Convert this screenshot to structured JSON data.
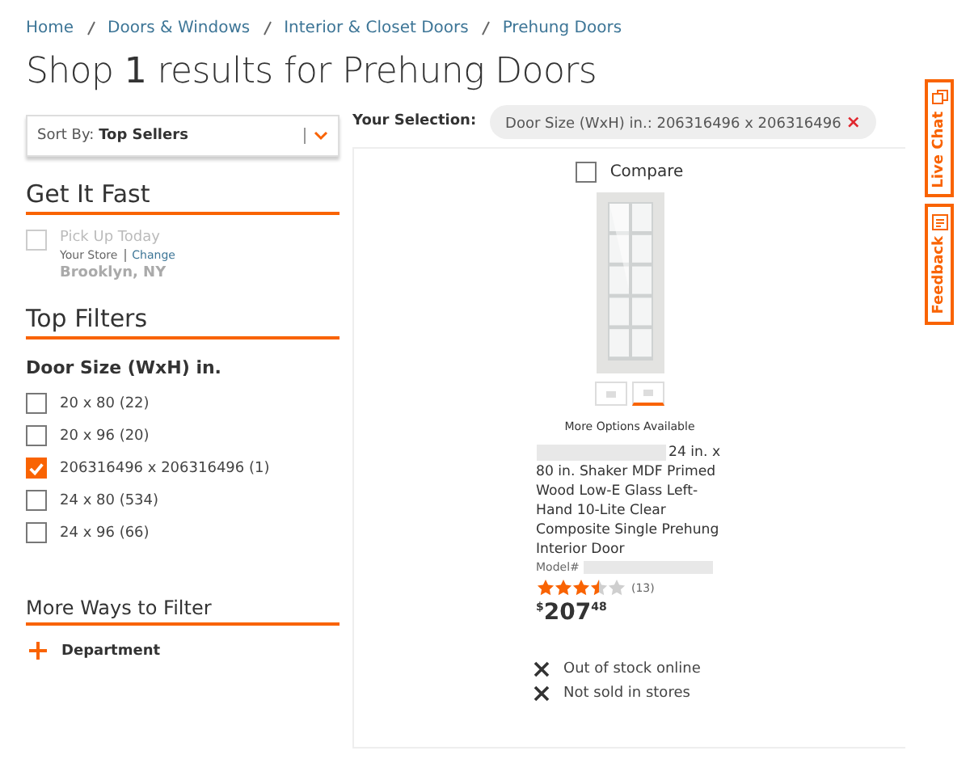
{
  "breadcrumbs": [
    "Home",
    "Doors & Windows",
    "Interior & Closet Doors",
    "Prehung Doors"
  ],
  "heading": "Shop **1** results for Prehung Doors",
  "sort": {
    "label": "Sort By:",
    "value": "Top Sellers"
  },
  "get_it_fast": {
    "title": "Get It Fast",
    "option": {
      "label": "Pick Up Today",
      "checked": false,
      "disabled": true
    },
    "store_label": "Your Store",
    "change_link": "Change",
    "store": "Brooklyn, NY"
  },
  "top_filters": {
    "title": "Top Filters",
    "group": "Door Size (WxH) in.",
    "options": [
      {
        "label": "20 x 80 (22)",
        "checked": false
      },
      {
        "label": "20 x 96 (20)",
        "checked": false
      },
      {
        "label": "206316496 x 206316496 (1)",
        "checked": true
      },
      {
        "label": "24 x 80 (534)",
        "checked": false
      },
      {
        "label": "24 x 96 (66)",
        "checked": false
      }
    ]
  },
  "more_ways": {
    "title": "More Ways to Filter",
    "items": [
      "Department"
    ]
  },
  "selection": {
    "label": "Your Selection:",
    "chip": "Door Size (WxH) in.: 206316496 x 206316496",
    "remove": "×"
  },
  "product": {
    "compare": {
      "label": "Compare",
      "checked": false
    },
    "thumbnails": [
      {
        "selected": false
      },
      {
        "selected": true
      }
    ],
    "more_options": "More Options Available",
    "title": "24 in. x 80 in. Shaker MDF Primed Wood Low-E Glass Left-Hand 10-Lite Clear Composite Single Prehung Interior Door",
    "model_label": "Model#",
    "stars": 3.5,
    "reviews": "(13)",
    "price": {
      "currency": "$",
      "dollars": "207",
      "cents": "48"
    },
    "availability": [
      "Out of stock online",
      "Not sold in stores"
    ]
  },
  "side_tabs": [
    "Live Chat",
    "Feedback"
  ]
}
